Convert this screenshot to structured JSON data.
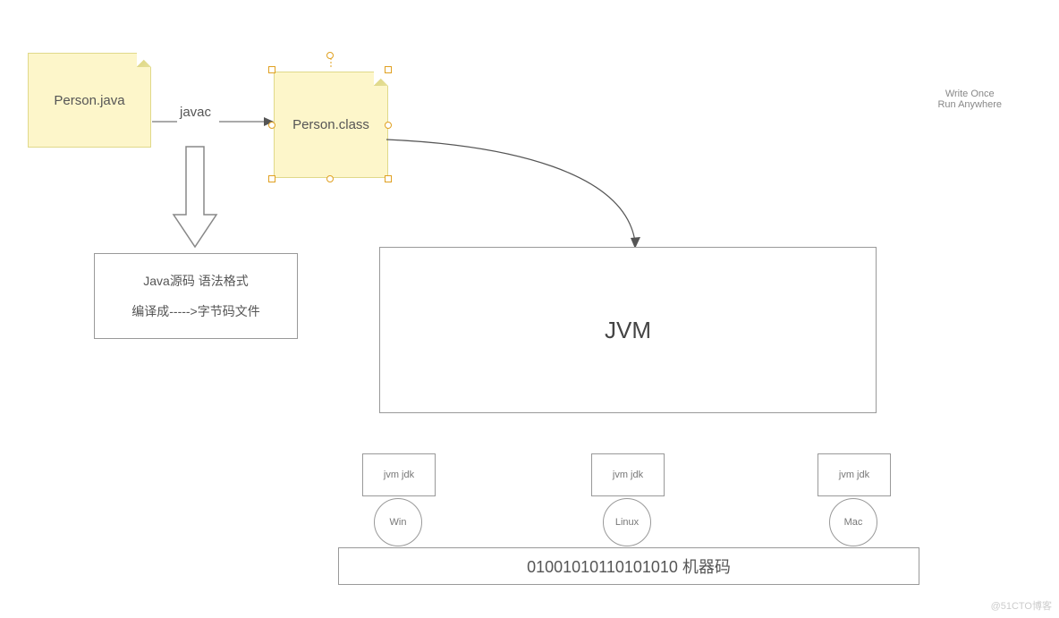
{
  "note_source": "Person.java",
  "note_class": "Person.class",
  "label_javac": "javac",
  "desc_line1": "Java源码 语法格式",
  "desc_line2": "编译成----->字节码文件",
  "jvm_label": "JVM",
  "slogan_line1": "Write Once",
  "slogan_line2": "Run Anywhere",
  "platform_box_label": "jvm  jdk",
  "os1": "Win",
  "os2": "Linux",
  "os3": "Mac",
  "machine_code": "01001010110101010   机器码",
  "watermark": "@51CTO博客"
}
